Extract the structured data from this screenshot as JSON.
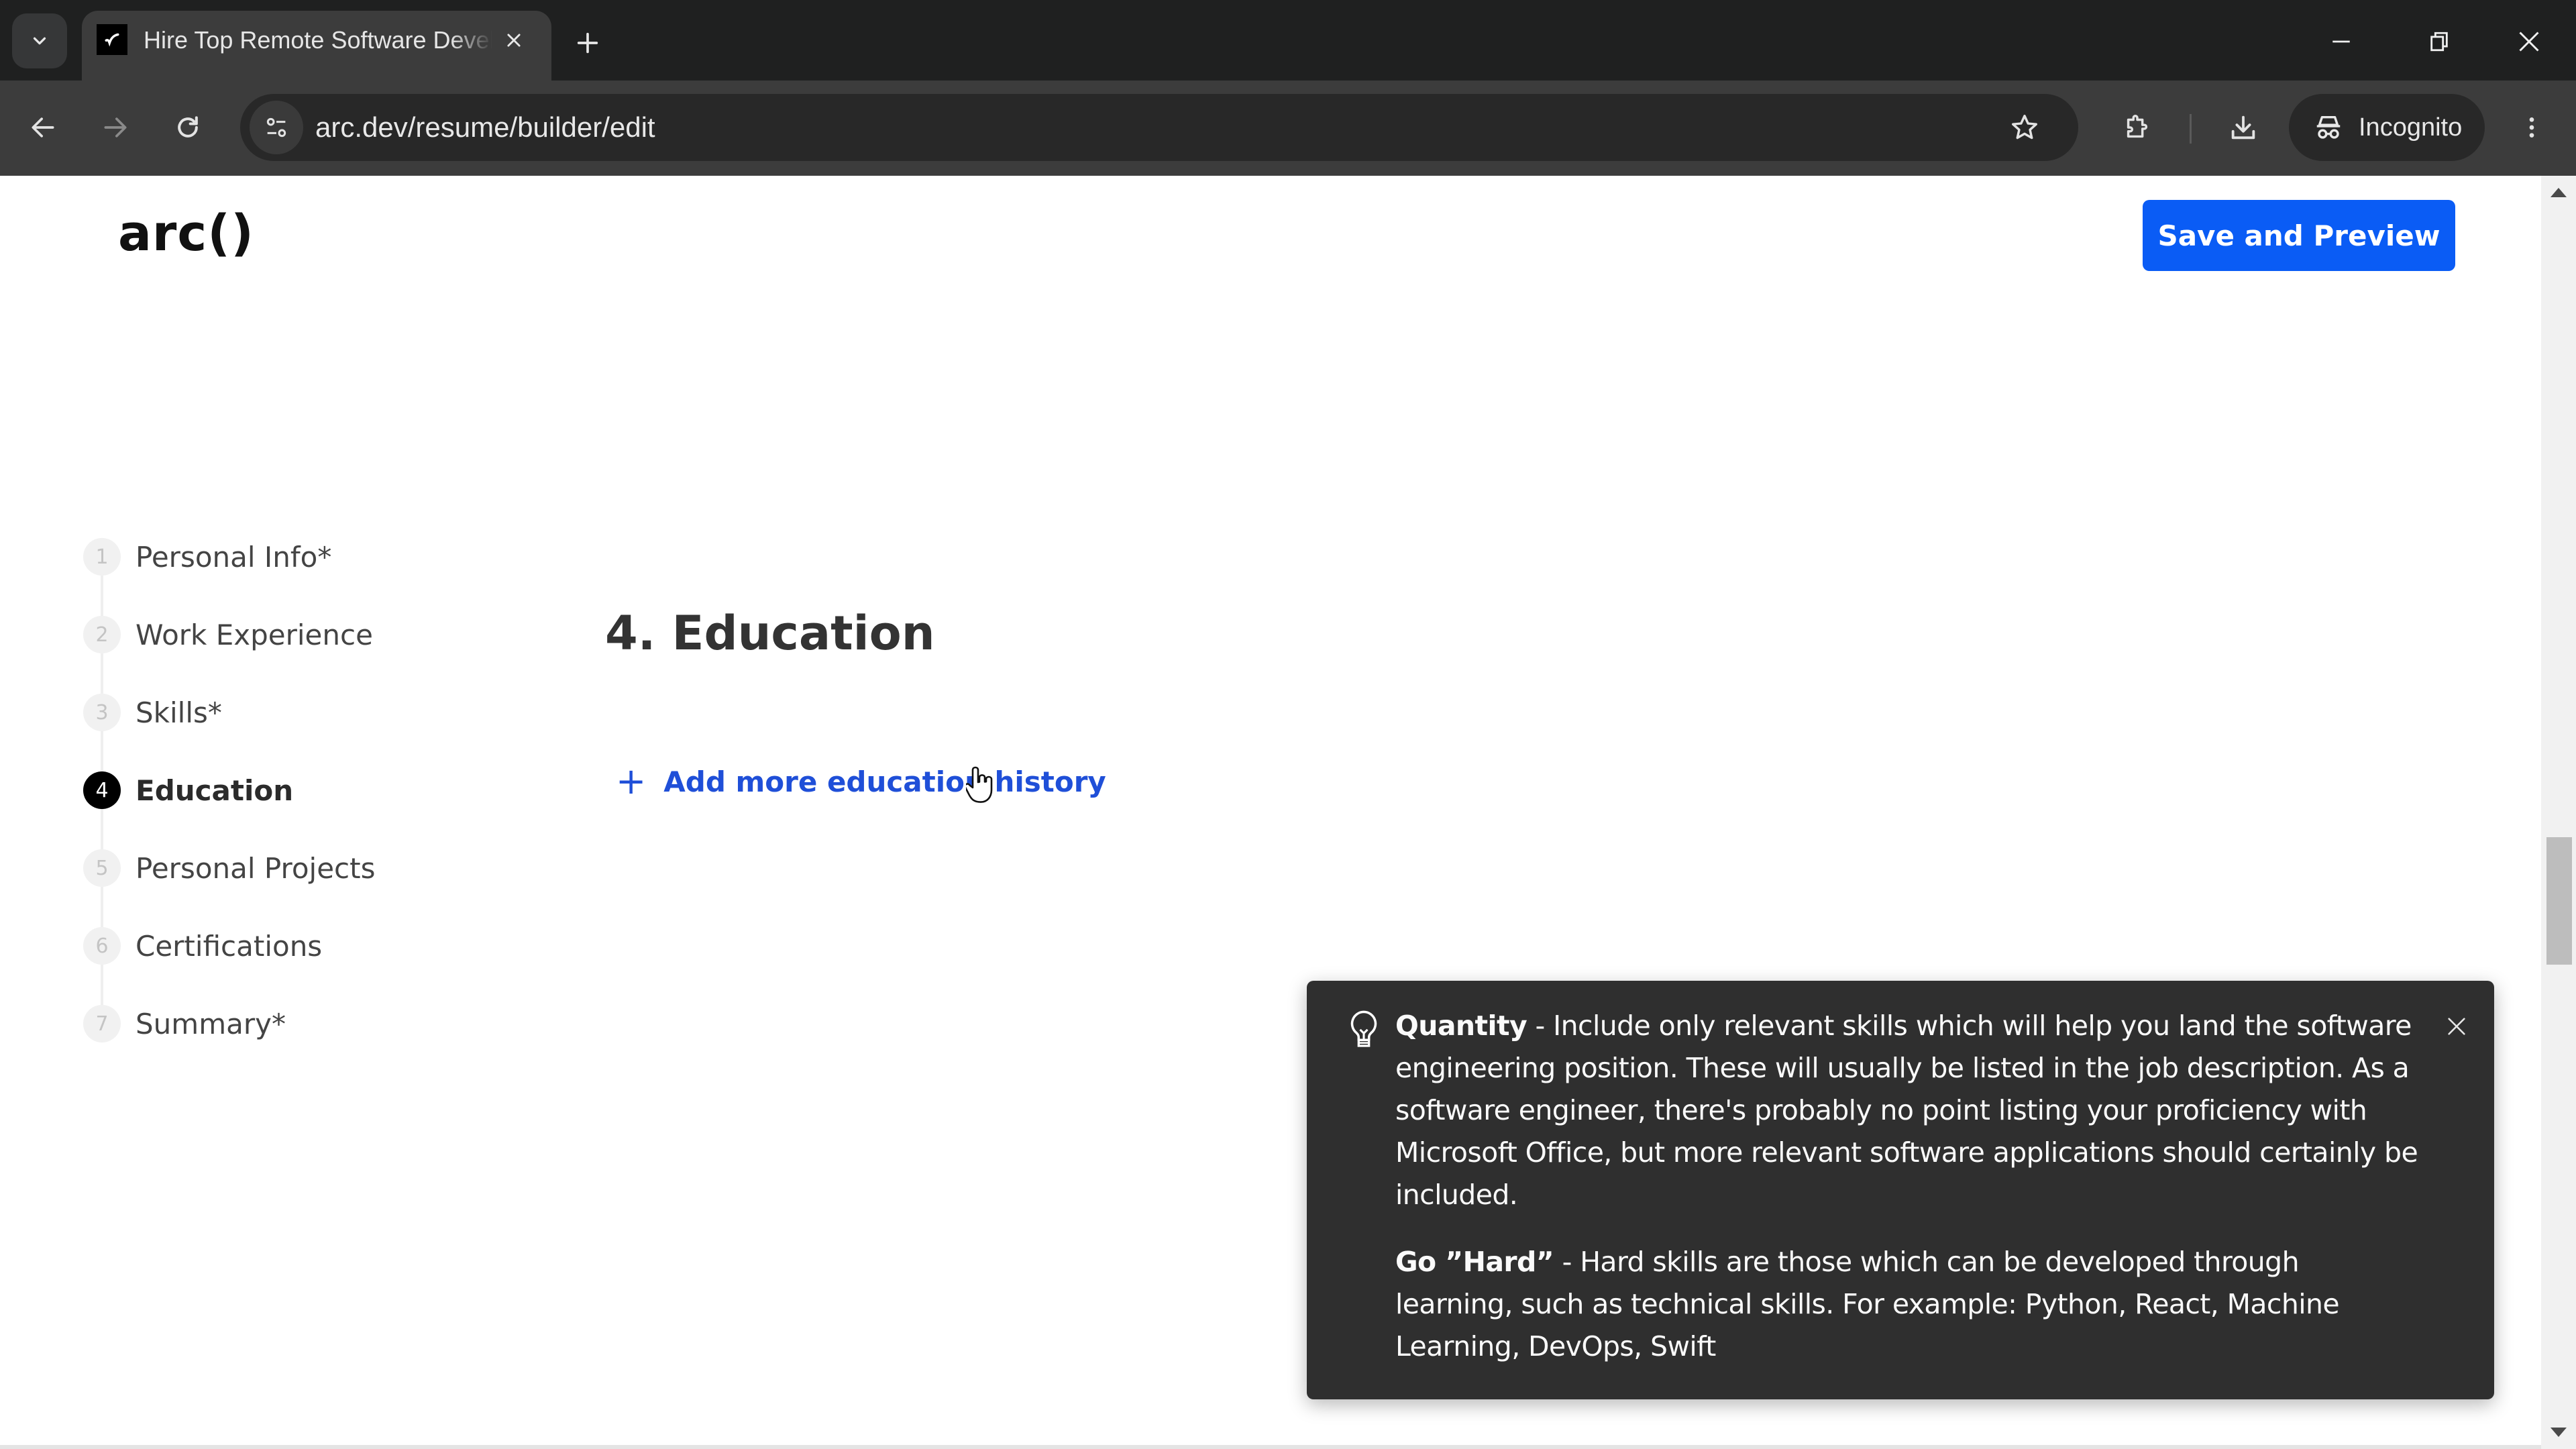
{
  "browser": {
    "tab_title": "Hire Top Remote Software Developers",
    "url": "arc.dev/resume/builder/edit",
    "profile_label": "Incognito",
    "icons": {
      "tab_search": "chevron-down-icon",
      "favicon": "arc-checkmark-icon",
      "tab_close": "close-icon",
      "new_tab": "plus-icon",
      "minimize": "minimize-icon",
      "restore": "restore-icon",
      "close_window": "close-icon",
      "back": "arrow-left-icon",
      "forward": "arrow-right-icon",
      "reload": "reload-icon",
      "site_info": "tune-icon",
      "bookmark": "star-icon",
      "extensions": "puzzle-icon",
      "downloads": "download-icon",
      "incognito": "incognito-icon",
      "menu": "more-vert-icon"
    }
  },
  "header": {
    "logo": "arc()",
    "save_button": "Save and Preview",
    "accent_color": "#0a5cf5"
  },
  "steps": {
    "active_index": 4,
    "items": [
      {
        "number": "1",
        "label": "Personal Info*"
      },
      {
        "number": "2",
        "label": "Work Experience"
      },
      {
        "number": "3",
        "label": "Skills*"
      },
      {
        "number": "4",
        "label": "Education"
      },
      {
        "number": "5",
        "label": "Personal Projects"
      },
      {
        "number": "6",
        "label": "Certifications"
      },
      {
        "number": "7",
        "label": "Summary*"
      }
    ]
  },
  "main": {
    "section_title": "4. Education",
    "add_link_icon": "plus-icon",
    "add_link_label": "Add more education history",
    "link_color": "#1f4fd8"
  },
  "tip": {
    "icon": "lightbulb-icon",
    "close_icon": "close-icon",
    "paragraphs": [
      {
        "title": "Quantity",
        "text": " - Include only relevant skills which will help you land the software engineering position. These will usually be listed in the job description. As a software engineer, there's probably no point listing your proficiency with Microsoft Office, but more relevant software applications should certainly be included."
      },
      {
        "title": "Go ”Hard”",
        "text": " - Hard skills are those which can be developed through learning, such as technical skills. For example: Python, React, Machine Learning, DevOps, Swift"
      }
    ]
  },
  "scrollbar": {
    "vertical_position_fraction": 0.58
  }
}
